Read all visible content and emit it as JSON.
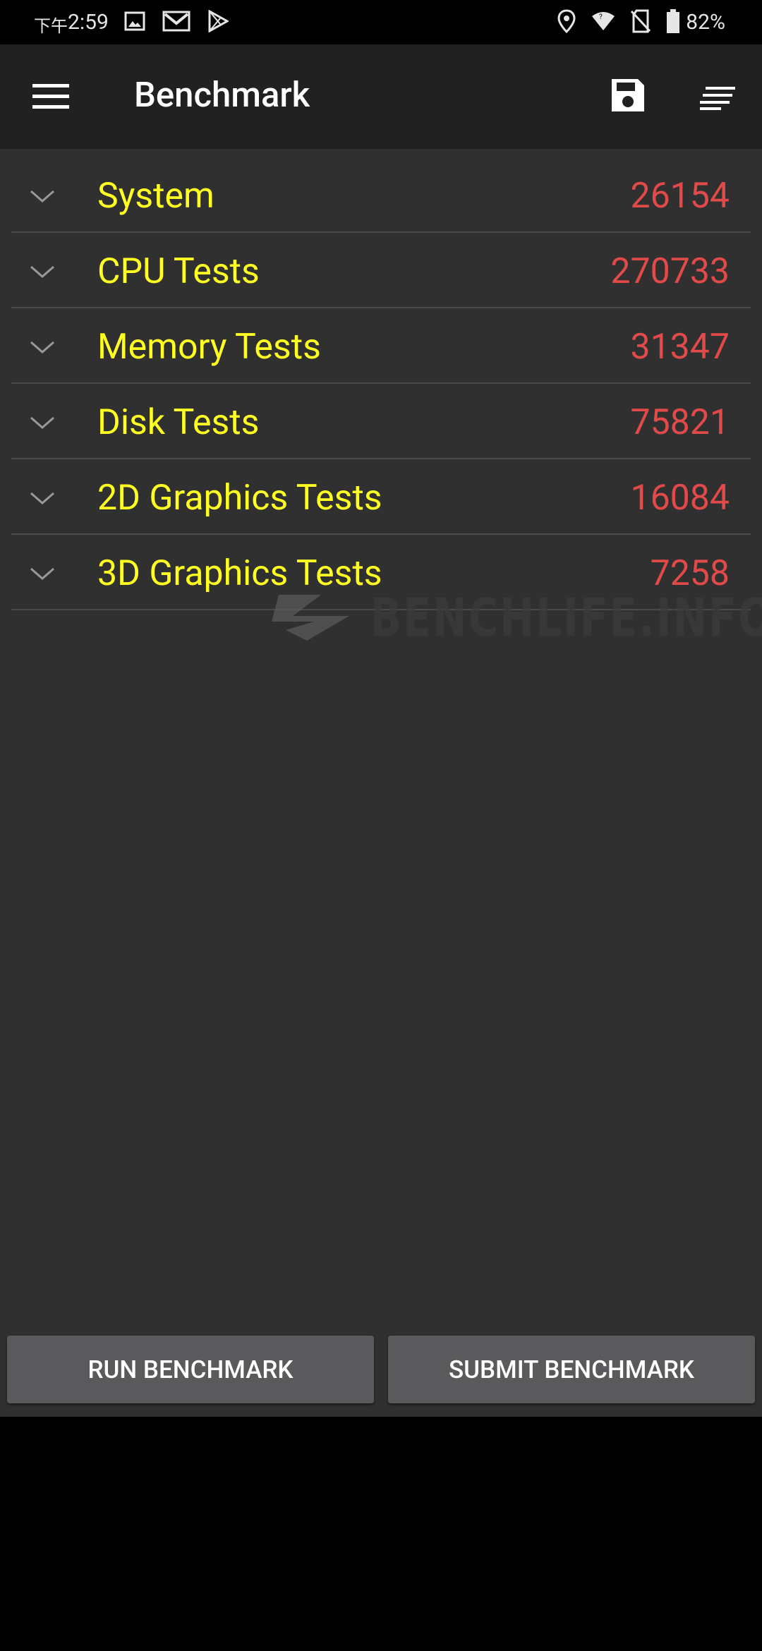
{
  "status_bar": {
    "time_prefix": "下午",
    "time": "2:59",
    "left_icons": [
      "image-icon",
      "gmail-icon",
      "play-store-icon"
    ],
    "right_icons": [
      "location-icon",
      "wifi-icon",
      "no-sim-icon",
      "battery-icon"
    ],
    "battery": "82%"
  },
  "toolbar": {
    "title": "Benchmark",
    "icons": [
      "menu-icon",
      "save-icon",
      "sort-icon"
    ]
  },
  "results": [
    {
      "label": "System",
      "score": "26154"
    },
    {
      "label": "CPU Tests",
      "score": "270733"
    },
    {
      "label": "Memory Tests",
      "score": "31347"
    },
    {
      "label": "Disk Tests",
      "score": "75821"
    },
    {
      "label": "2D Graphics Tests",
      "score": "16084"
    },
    {
      "label": "3D Graphics Tests",
      "score": "7258"
    }
  ],
  "watermark": "BENCHLIFE.INFO",
  "actions": {
    "run_label": "RUN BENCHMARK",
    "submit_label": "SUBMIT BENCHMARK"
  },
  "colors": {
    "label": "#ffff21",
    "score": "#e24a4a",
    "toolbar_bg": "#212121",
    "content_bg": "#303030",
    "button_bg": "#5a5a5c"
  }
}
